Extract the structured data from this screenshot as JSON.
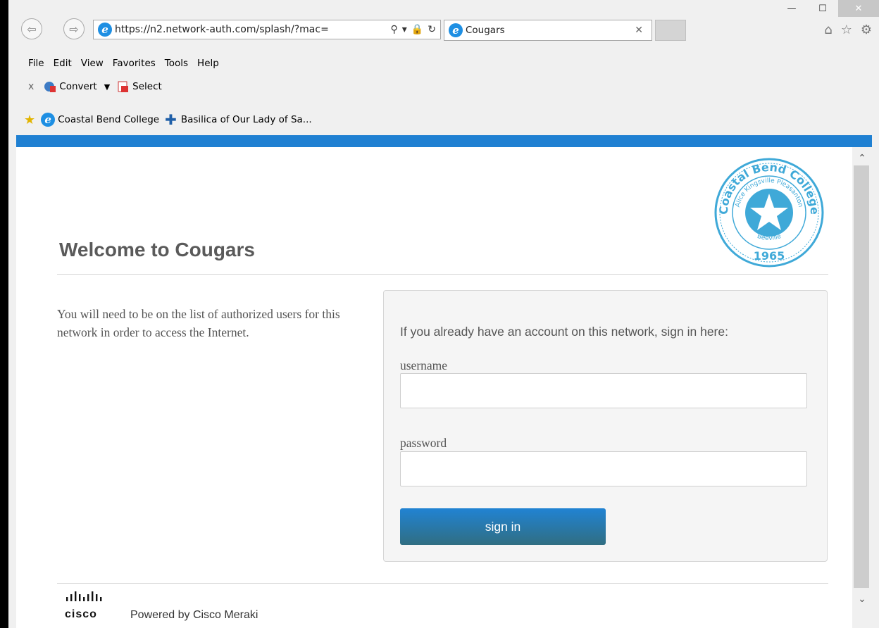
{
  "browser": {
    "url": "https://n2.network-auth.com/splash/?mac=",
    "tab_title": "Cougars",
    "menu": [
      "File",
      "Edit",
      "View",
      "Favorites",
      "Tools",
      "Help"
    ],
    "commands": {
      "convert": "Convert",
      "select": "Select"
    },
    "favorites": [
      "Coastal Bend College",
      "Basilica of Our Lady of Sa..."
    ]
  },
  "page": {
    "title": "Welcome to Cougars",
    "intro": "You will need to be on the list of authorized users for this network in order to access the Internet.",
    "login": {
      "prompt": "If you already have an account on this network, sign in here:",
      "username_label": "username",
      "password_label": "password",
      "username_value": "",
      "password_value": "",
      "sign_in_label": "sign in"
    },
    "seal": {
      "top_text": "Coastal Bend College",
      "inner_text": "Alice Kingsville Pleasanton",
      "bottom_text": "Beeville",
      "year": "1965"
    },
    "footer": {
      "cisco": "cisco",
      "powered": "Powered by Cisco Meraki"
    }
  },
  "colors": {
    "accent": "#1f80d2",
    "button_top": "#2183d3",
    "button_bottom": "#306e82",
    "seal": "#3fa9d8"
  }
}
